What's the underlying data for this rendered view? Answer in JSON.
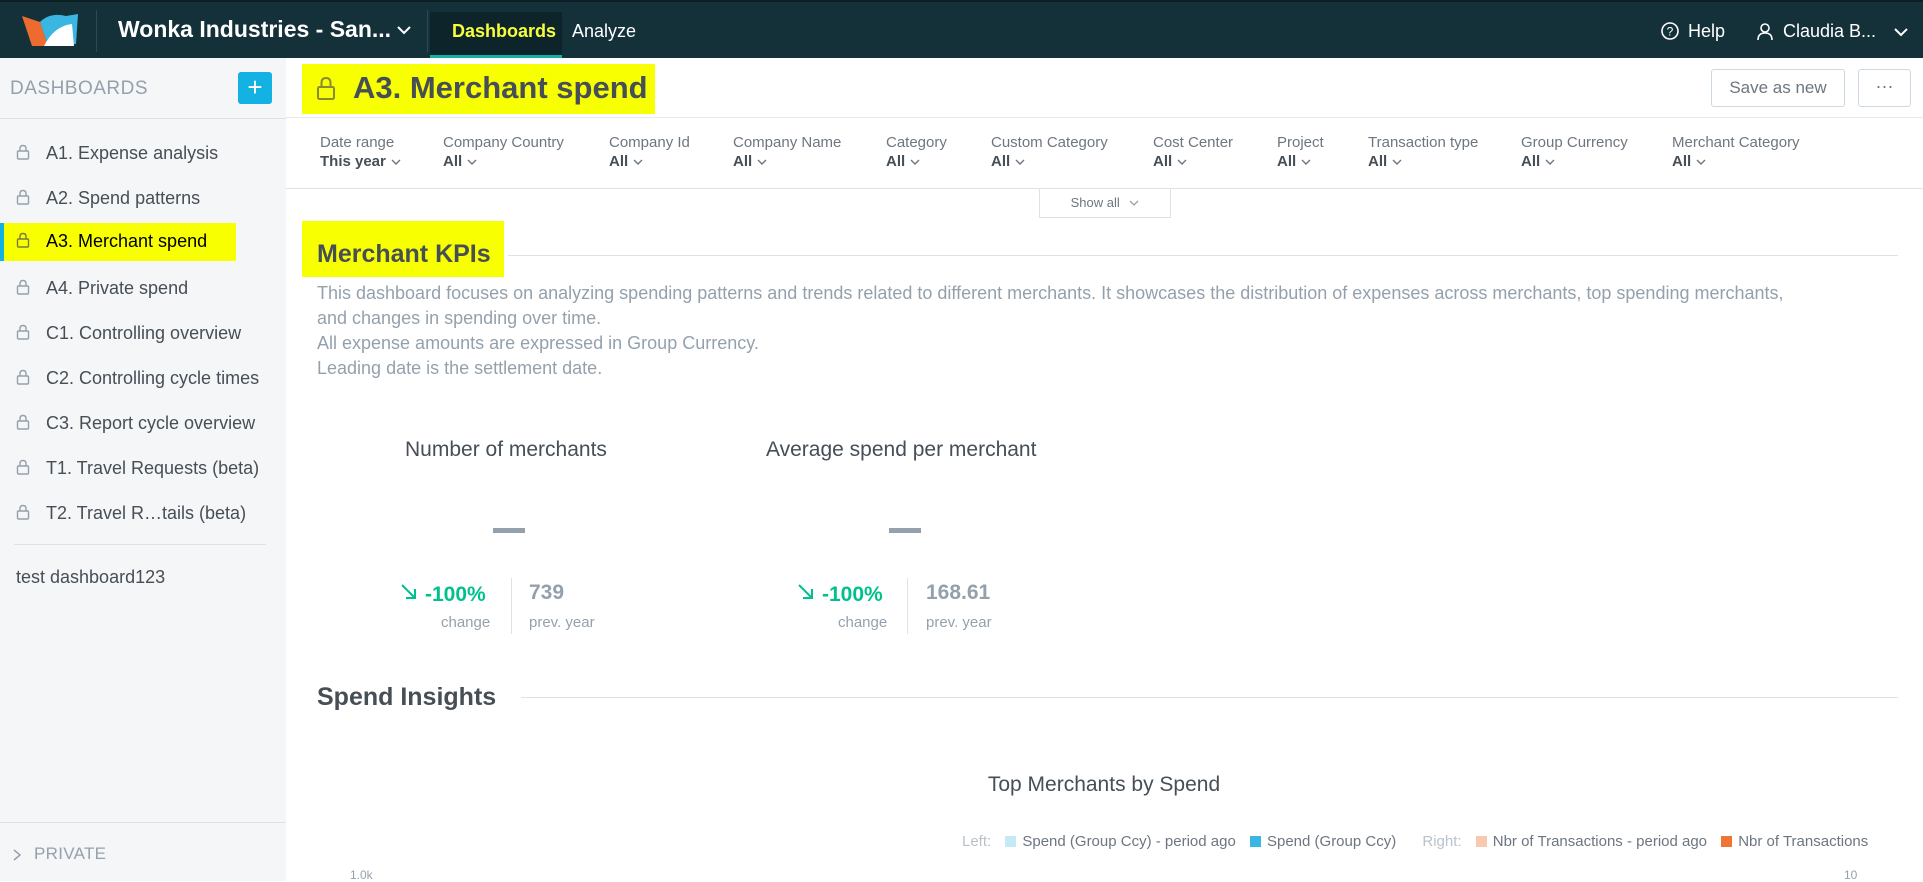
{
  "topbar": {
    "workspace_name": "Wonka Industries - San...",
    "tabs": [
      {
        "label": "Dashboards",
        "active": true
      },
      {
        "label": "Analyze",
        "active": false
      }
    ],
    "help_label": "Help",
    "user_label": "Claudia B...",
    "colors": {
      "background": "#14313a",
      "active_tab_text": "#f7ff3c",
      "active_tab_underline": "#14b2a3"
    }
  },
  "sidebar": {
    "title": "DASHBOARDS",
    "add_label": "+",
    "items": [
      {
        "label": "A1. Expense analysis",
        "active": false
      },
      {
        "label": "A2. Spend patterns",
        "active": false
      },
      {
        "label": "A3. Merchant spend",
        "active": true
      },
      {
        "label": "A4. Private spend",
        "active": false
      },
      {
        "label": "C1. Controlling overview",
        "active": false
      },
      {
        "label": "C2. Controlling cycle times",
        "active": false
      },
      {
        "label": "C3. Report cycle overview",
        "active": false
      },
      {
        "label": "T1. Travel Requests (beta)",
        "active": false
      },
      {
        "label": "T2. Travel R…tails (beta)",
        "active": false
      }
    ],
    "extra_item": "test dashboard123",
    "private_label": "PRIVATE",
    "highlight_color": "#f7ff00",
    "accent_color": "#14b2e2"
  },
  "header": {
    "title": "A3. Merchant spend",
    "save_as_new": "Save as new",
    "more": "···"
  },
  "filters": [
    {
      "label": "Date range",
      "value": "This year"
    },
    {
      "label": "Company Country",
      "value": "All"
    },
    {
      "label": "Company Id",
      "value": "All"
    },
    {
      "label": "Company Name",
      "value": "All"
    },
    {
      "label": "Category",
      "value": "All"
    },
    {
      "label": "Custom Category",
      "value": "All"
    },
    {
      "label": "Cost Center",
      "value": "All"
    },
    {
      "label": "Project",
      "value": "All"
    },
    {
      "label": "Transaction type",
      "value": "All"
    },
    {
      "label": "Group Currency",
      "value": "All"
    },
    {
      "label": "Merchant Category",
      "value": "All"
    }
  ],
  "show_all_label": "Show all",
  "kpi_section": {
    "title": "Merchant KPIs",
    "description": [
      "This dashboard focuses on analyzing spending patterns and trends related to different merchants. It showcases the distribution of expenses across merchants, top spending merchants, and changes in spending over time.",
      "All expense amounts are expressed in Group Currency.",
      "Leading date is the settlement date."
    ],
    "kpis": [
      {
        "label": "Number of merchants",
        "value": "—",
        "change": "-100%",
        "change_label": "change",
        "prev_value": "739",
        "prev_label": "prev. year"
      },
      {
        "label": "Average spend per merchant",
        "value": "—",
        "change": "-100%",
        "change_label": "change",
        "prev_value": "168.61",
        "prev_label": "prev. year"
      }
    ],
    "positive_color": "#00c18d"
  },
  "insights_section": {
    "title": "Spend Insights",
    "chart_title": "Top Merchants by Spend",
    "legend": {
      "left_label": "Left:",
      "left_items": [
        {
          "label": "Spend (Group Ccy) - period ago",
          "color": "#c5e9f5"
        },
        {
          "label": "Spend (Group Ccy)",
          "color": "#3ab6e3"
        }
      ],
      "right_label": "Right:",
      "right_items": [
        {
          "label": "Nbr of Transactions - period ago",
          "color": "#f7c9ae"
        },
        {
          "label": "Nbr of Transactions",
          "color": "#ef7534"
        }
      ]
    },
    "axis_left_tick": "1.0k",
    "axis_right_tick": "10"
  }
}
